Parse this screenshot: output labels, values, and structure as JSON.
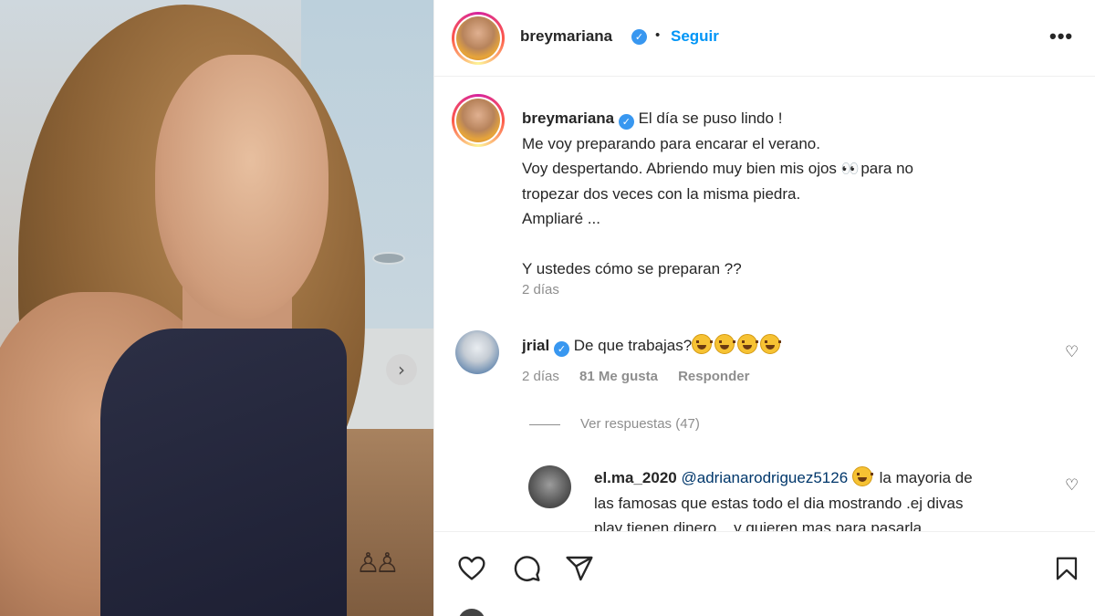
{
  "post": {
    "username": "breymariana",
    "follow_label": "Seguir",
    "dot": "•",
    "more_label": "•••",
    "next_icon": "chevron-right-icon"
  },
  "caption": {
    "username": "breymariana",
    "lines": [
      "El día se puso lindo !",
      "Me voy preparando para encarar el verano.",
      "Voy despertando. Abriendo muy bien mis ojos",
      "para no",
      "tropezar dos veces con la misma piedra.",
      "Ampliaré ...",
      "Y ustedes cómo se preparan ??"
    ],
    "eyes_emoji": "👀",
    "time": "2 días"
  },
  "comments": [
    {
      "username": "jrial",
      "text": "De que trabajas?",
      "emojis": [
        "laughing-crying",
        "laughing-crying",
        "laughing-crying",
        "laughing-crying"
      ],
      "time": "2 días",
      "likes": "81 Me gusta",
      "reply_label": "Responder",
      "view_replies": "Ver respuestas (47)"
    },
    {
      "username": "el.ma_2020",
      "mention": "@adrianarodriguez5126",
      "text_line1": "la mayoria de",
      "text_line2": "las famosas que estas todo el dia mostrando .ej divas",
      "text_line3": "play tienen dinero... y quieren mas para pasarla"
    }
  ],
  "actions": {
    "like_icon": "heart-icon",
    "comment_icon": "comment-icon",
    "share_icon": "paper-plane-icon",
    "save_icon": "bookmark-icon"
  }
}
